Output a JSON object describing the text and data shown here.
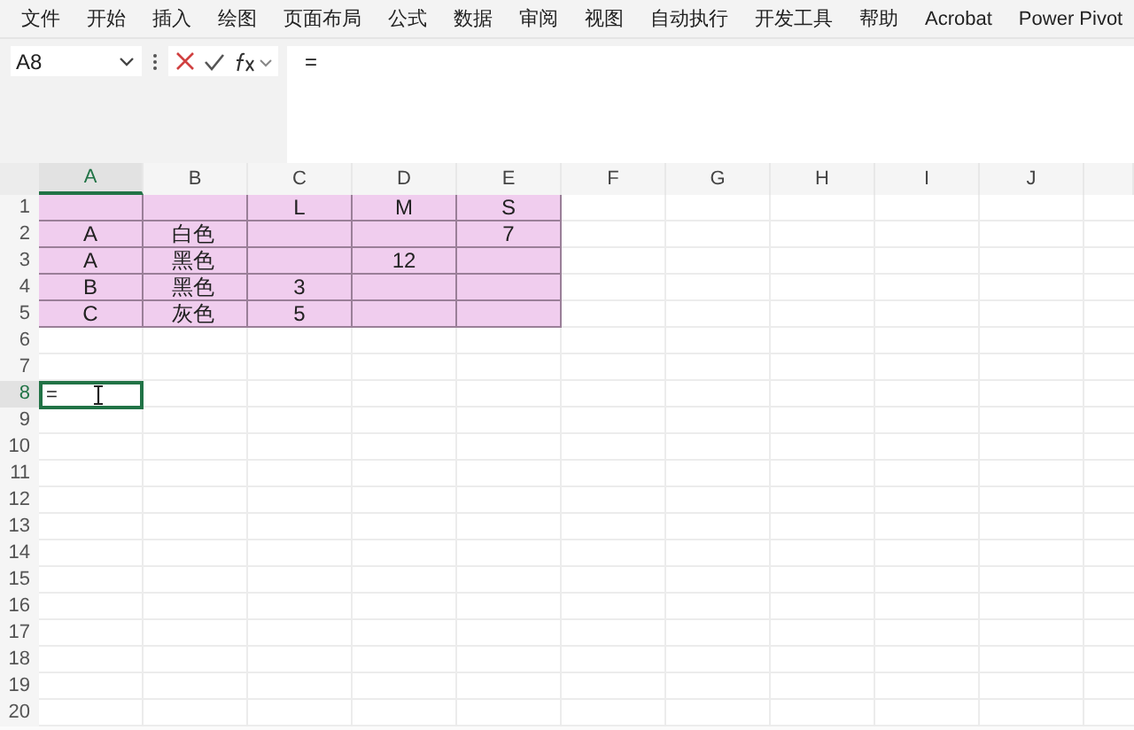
{
  "menu": [
    "文件",
    "开始",
    "插入",
    "绘图",
    "页面布局",
    "公式",
    "数据",
    "审阅",
    "视图",
    "自动执行",
    "开发工具",
    "帮助",
    "Acrobat",
    "Power Pivot"
  ],
  "formula_bar": {
    "name_box": "A8",
    "formula": "="
  },
  "columns": [
    {
      "label": "A",
      "selected": true
    },
    {
      "label": "B",
      "selected": false
    },
    {
      "label": "C",
      "selected": false
    },
    {
      "label": "D",
      "selected": false
    },
    {
      "label": "E",
      "selected": false
    },
    {
      "label": "F",
      "selected": false
    },
    {
      "label": "G",
      "selected": false
    },
    {
      "label": "H",
      "selected": false
    },
    {
      "label": "I",
      "selected": false
    },
    {
      "label": "J",
      "selected": false
    }
  ],
  "rows": [
    {
      "label": "1",
      "selected": false,
      "shaded": true,
      "cells": [
        null,
        null,
        "L",
        "M",
        "S"
      ]
    },
    {
      "label": "2",
      "selected": false,
      "shaded": true,
      "cells": [
        "A",
        "白色",
        null,
        null,
        "7"
      ]
    },
    {
      "label": "3",
      "selected": false,
      "shaded": true,
      "cells": [
        "A",
        "黑色",
        null,
        "12",
        null
      ]
    },
    {
      "label": "4",
      "selected": false,
      "shaded": true,
      "cells": [
        "B",
        "黑色",
        "3",
        null,
        null
      ]
    },
    {
      "label": "5",
      "selected": false,
      "shaded": true,
      "cells": [
        "C",
        "灰色",
        "5",
        null,
        null
      ]
    },
    {
      "label": "6",
      "selected": false
    },
    {
      "label": "7",
      "selected": false
    },
    {
      "label": "8",
      "selected": true
    },
    {
      "label": "9",
      "selected": false
    },
    {
      "label": "10",
      "selected": false
    },
    {
      "label": "11",
      "selected": false
    },
    {
      "label": "12",
      "selected": false
    },
    {
      "label": "13",
      "selected": false
    },
    {
      "label": "14",
      "selected": false
    },
    {
      "label": "15",
      "selected": false
    },
    {
      "label": "16",
      "selected": false
    },
    {
      "label": "17",
      "selected": false
    },
    {
      "label": "18",
      "selected": false
    },
    {
      "label": "19",
      "selected": false
    },
    {
      "label": "20",
      "selected": false
    }
  ],
  "active_cell": {
    "value": "="
  }
}
